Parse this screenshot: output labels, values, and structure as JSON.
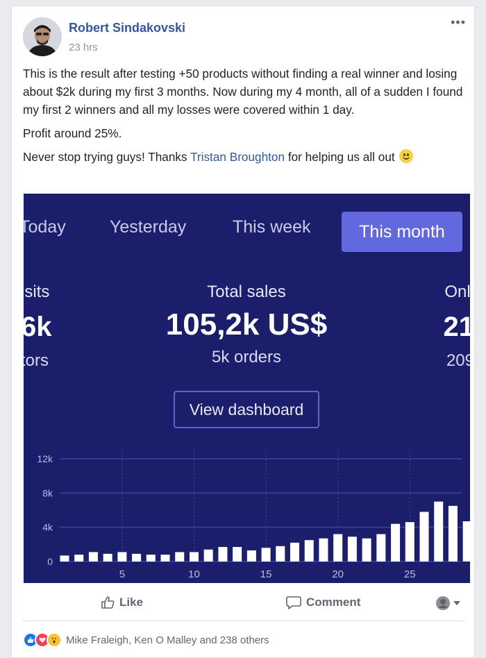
{
  "post": {
    "author": "Robert Sindakovski",
    "time": "23 hrs",
    "more_label": "•••",
    "paragraph1": "This is the result after testing +50 products without finding a real winner and losing about $2k during my first 3 months. Now during my 4 month, all of a sudden I found my first 2 winners and all my losses were covered within 1 day.",
    "paragraph2": "Profit around 25%.",
    "paragraph3_prefix": "Never stop trying guys! Thanks ",
    "mention": "Tristan Broughton",
    "paragraph3_suffix": " for helping us all out "
  },
  "screenshot": {
    "tabs": [
      "Today",
      "Yesterday",
      "This week",
      "This month"
    ],
    "active_tab": "This month",
    "left_stat": {
      "label": "isits",
      "value": "6k",
      "sub": "tors"
    },
    "center_stat": {
      "label": "Total sales",
      "value": "105,2k US$",
      "sub": "5k orders"
    },
    "right_stat": {
      "label": "Onli",
      "value": "21",
      "sub": "209"
    },
    "dashboard_button": "View dashboard"
  },
  "chart_data": {
    "type": "bar",
    "x": [
      1,
      2,
      3,
      4,
      5,
      6,
      7,
      8,
      9,
      10,
      11,
      12,
      13,
      14,
      15,
      16,
      17,
      18,
      19,
      20,
      21,
      22,
      23,
      24,
      25,
      26,
      27,
      28
    ],
    "values": [
      700,
      800,
      1100,
      900,
      1100,
      900,
      800,
      800,
      1100,
      1100,
      1400,
      1700,
      1700,
      1300,
      1600,
      1800,
      2200,
      2500,
      2700,
      3200,
      2900,
      2700,
      3200,
      4400,
      4600,
      5800,
      7000,
      6500,
      4700
    ],
    "x_ticks": [
      "5",
      "10",
      "15",
      "20",
      "25"
    ],
    "x_tick_values": [
      5,
      10,
      15,
      20,
      25
    ],
    "y_ticks": [
      "0",
      "4k",
      "8k",
      "12k"
    ],
    "y_tick_values": [
      0,
      4000,
      8000,
      12000
    ],
    "ylim": [
      0,
      12000
    ],
    "grid": true,
    "colors": {
      "background": "#1b1f6b",
      "bars": "#ffffff",
      "grid": "#3e43a6",
      "tick_text": "#b8bce6"
    }
  },
  "actions": {
    "like": "Like",
    "comment": "Comment"
  },
  "reactions": {
    "summary": "Mike Fraleigh, Ken O Malley and 238 others"
  },
  "colors": {
    "link": "#365899",
    "active_tab": "#6269de"
  }
}
